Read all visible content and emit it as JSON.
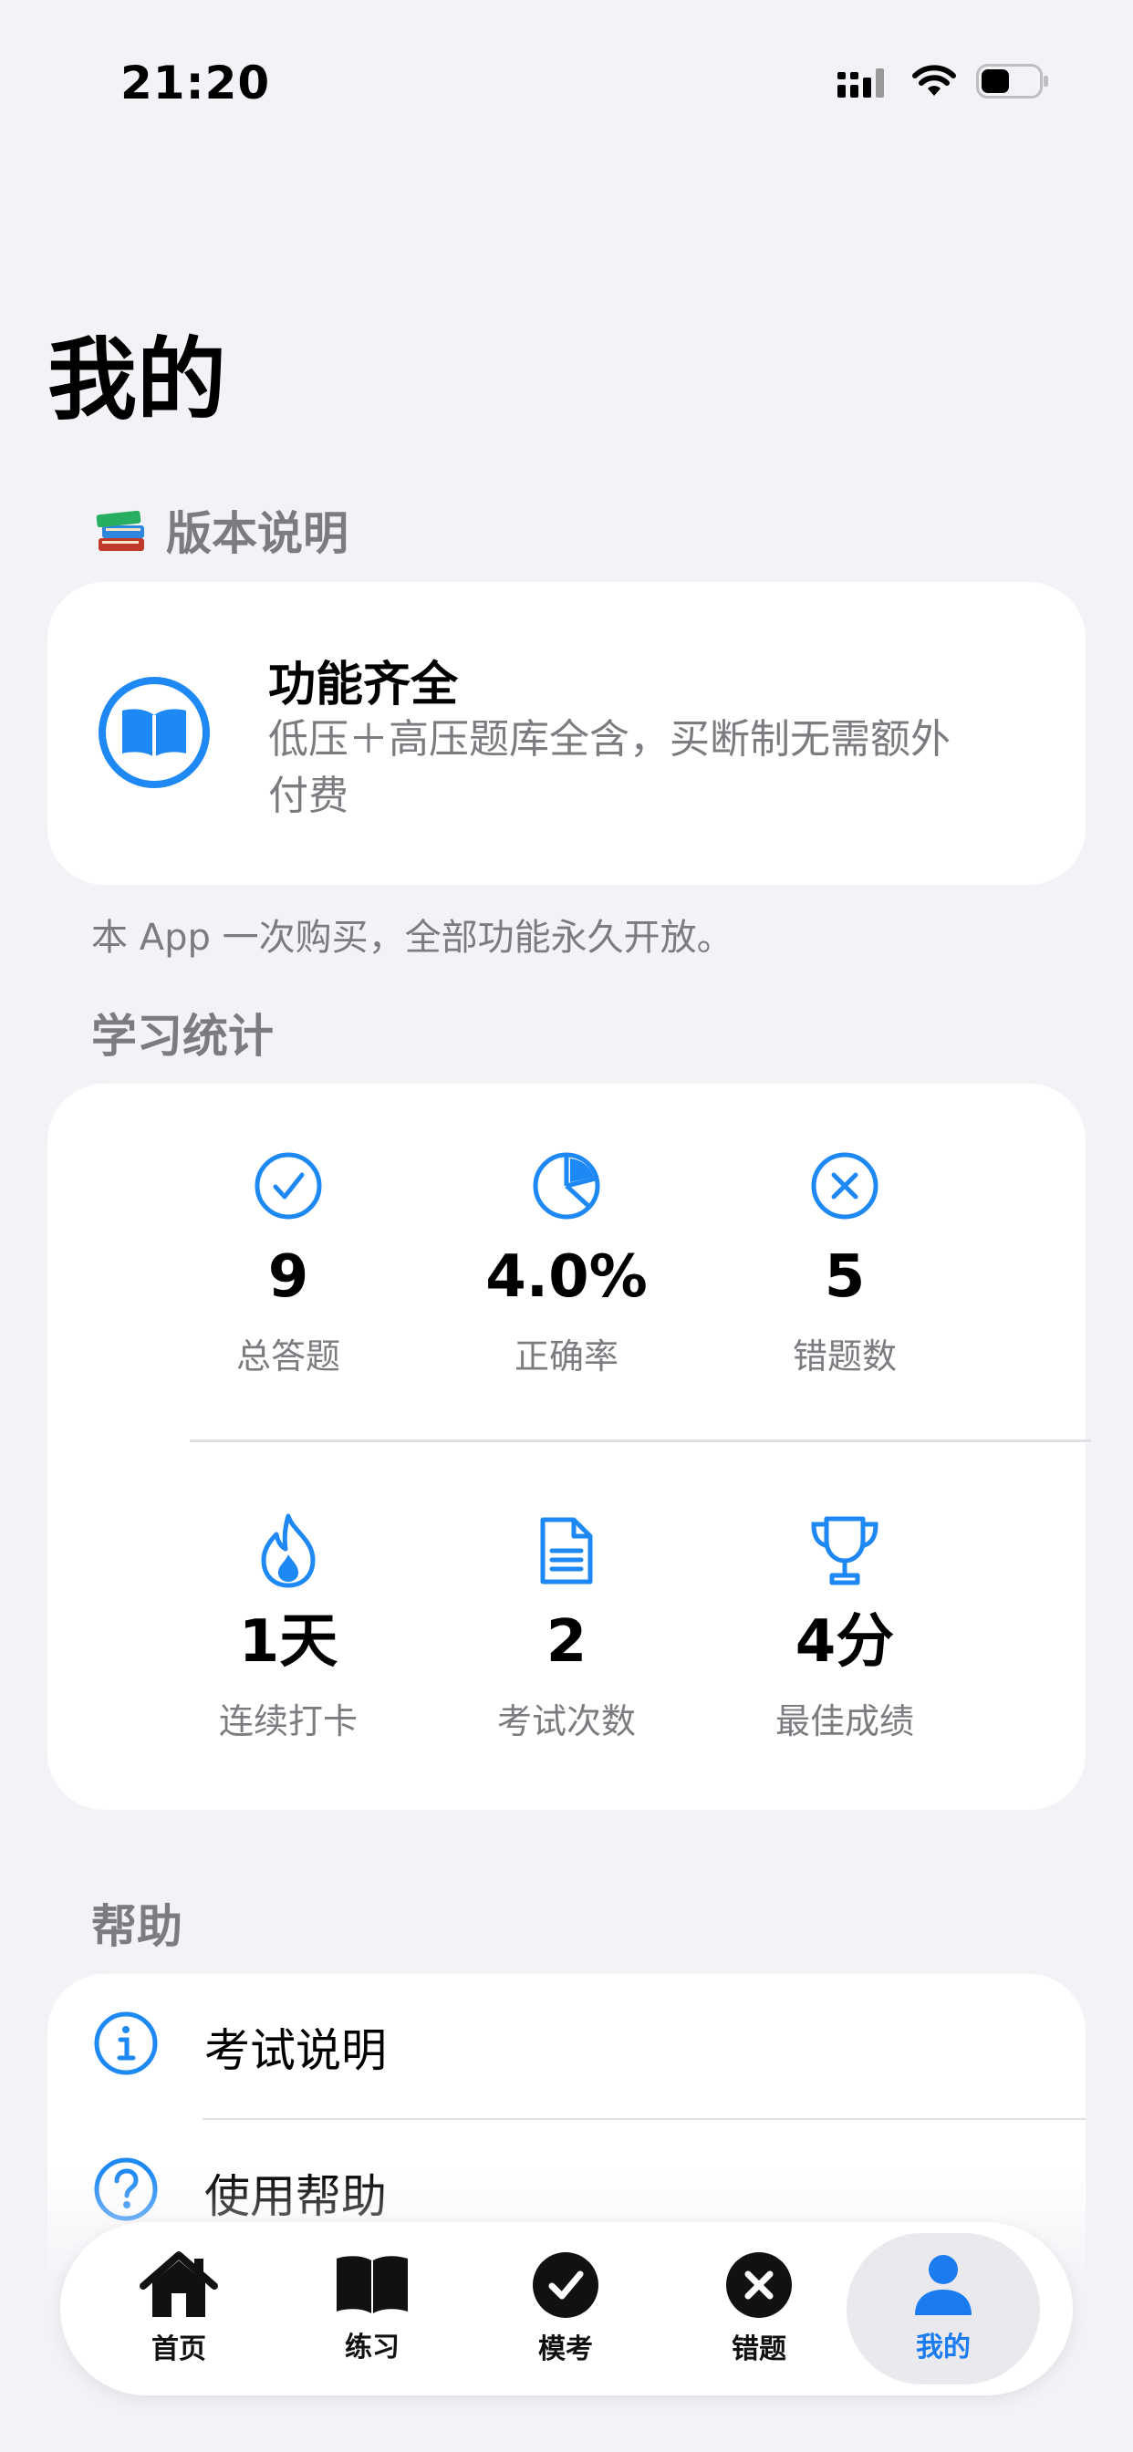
{
  "status_bar": {
    "time": "21:20"
  },
  "page_title": "我的",
  "version_section": {
    "title": "版本说明",
    "card_title": "功能齐全",
    "card_desc": "低压＋高压题库全含，买断制无需额外付费",
    "footnote": "本 App 一次购买，全部功能永久开放。"
  },
  "stats_section": {
    "title": "学习统计",
    "items": [
      {
        "icon": "checkmark-circle-icon",
        "value": "9",
        "label": "总答题"
      },
      {
        "icon": "pie-chart-icon",
        "value": "4.0%",
        "label": "正确率"
      },
      {
        "icon": "x-circle-icon",
        "value": "5",
        "label": "错题数"
      },
      {
        "icon": "flame-icon",
        "value": "1天",
        "label": "连续打卡"
      },
      {
        "icon": "document-icon",
        "value": "2",
        "label": "考试次数"
      },
      {
        "icon": "trophy-icon",
        "value": "4分",
        "label": "最佳成绩"
      }
    ]
  },
  "help_section": {
    "title": "帮助",
    "items": [
      {
        "icon": "info-icon",
        "label": "考试说明"
      },
      {
        "icon": "question-icon",
        "label": "使用帮助"
      }
    ]
  },
  "tab_bar": {
    "tabs": [
      {
        "icon": "house-icon",
        "label": "首页",
        "active": false
      },
      {
        "icon": "book-icon",
        "label": "练习",
        "active": false
      },
      {
        "icon": "checkmark-filled-icon",
        "label": "模考",
        "active": false
      },
      {
        "icon": "x-filled-icon",
        "label": "错题",
        "active": false
      },
      {
        "icon": "person-icon",
        "label": "我的",
        "active": true
      }
    ]
  },
  "colors": {
    "accent": "#1E88F5",
    "background": "#F2F2F7",
    "secondary_text": "#7B7B80"
  }
}
